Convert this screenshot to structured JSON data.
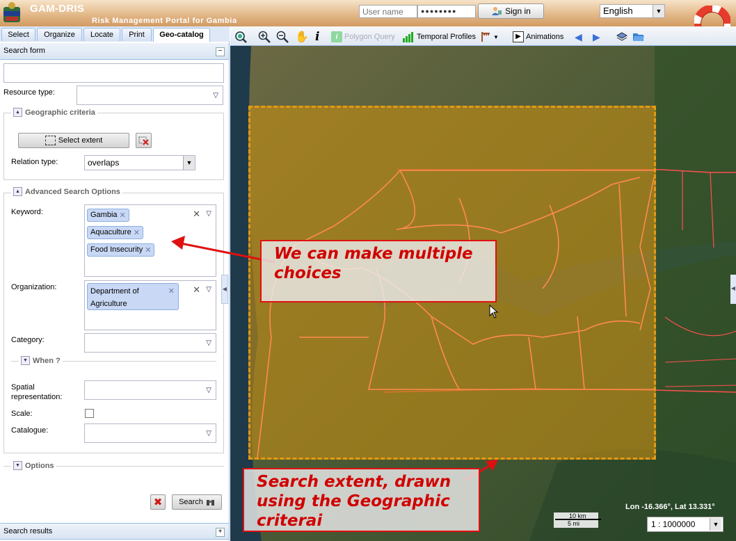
{
  "header": {
    "title": "GAM-DRIS",
    "subtitle": "Risk Management Portal for Gambia",
    "username_placeholder": "User name",
    "password_value": "●●●●●●●●",
    "signin_label": "Sign in",
    "language": "English"
  },
  "tabs": [
    {
      "label": "Select"
    },
    {
      "label": "Organize"
    },
    {
      "label": "Locate"
    },
    {
      "label": "Print"
    },
    {
      "label": "Geo-catalog",
      "active": true
    }
  ],
  "search_form": {
    "title": "Search form",
    "resource_type_label": "Resource type:",
    "geographic": {
      "legend": "Geographic criteria",
      "select_extent_label": "Select extent",
      "relation_label": "Relation type:",
      "relation_value": "overlaps"
    },
    "advanced": {
      "legend": "Advanced Search Options",
      "keyword_label": "Keyword:",
      "keywords": [
        "Gambia",
        "Aquaculture",
        "Food Insecurity"
      ],
      "organization_label": "Organization:",
      "organization_line1": "Department of",
      "organization_line2": "Agriculture",
      "category_label": "Category:",
      "when_legend": "When ?",
      "spatial_label_line1": "Spatial",
      "spatial_label_line2": "representation:",
      "scale_label": "Scale:",
      "catalogue_label": "Catalogue:"
    },
    "options_legend": "Options",
    "search_button": "Search",
    "results_title": "Search results"
  },
  "toolbar": {
    "polygon_query": "Polygon Query",
    "temporal_profiles": "Temporal Profiles",
    "animations": "Animations"
  },
  "map": {
    "coords": "Lon -16.366°, Lat 13.331°",
    "scale_km": "10 km",
    "scale_mi": "5 mi",
    "scale_value": "1 : 1000000",
    "note_choices_line1": "We can make multiple",
    "note_choices_line2": "choices",
    "note_extent_line1": "Search extent, drawn",
    "note_extent_line2": "using the Geographic",
    "note_extent_line3": "criterai"
  },
  "colors": {
    "annotation": "#e01010",
    "extent_fill": "#c48c14",
    "extent_border": "#e59a12",
    "header": "#d29a62"
  }
}
